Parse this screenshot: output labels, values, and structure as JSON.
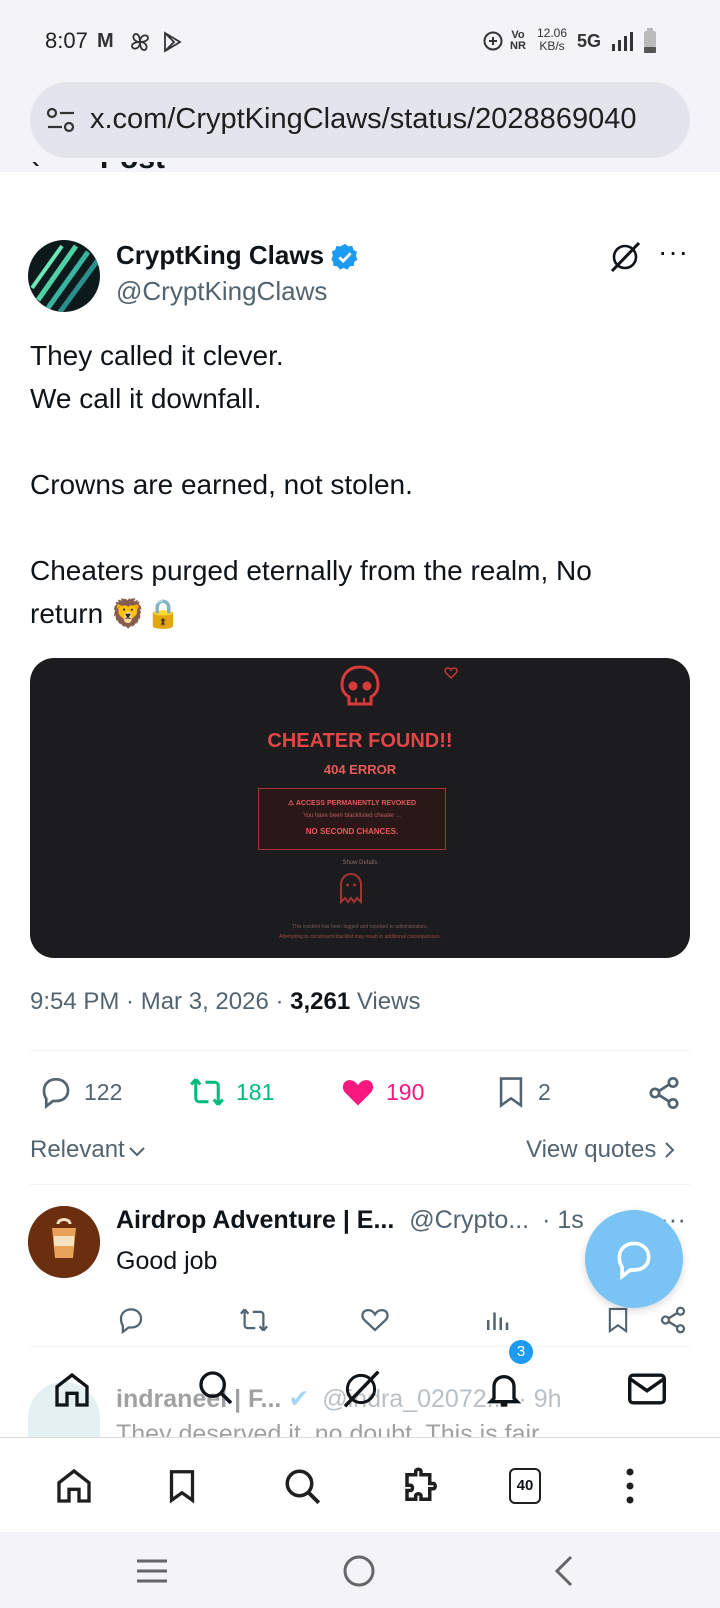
{
  "status_bar": {
    "time": "8:07",
    "app_icons": "M",
    "data_speed": "12.06",
    "data_unit": "KB/s",
    "network": "5G",
    "volte": "Vo",
    "volte2": "NR"
  },
  "browser": {
    "url": "x.com/CryptKingClaws/status/2028869040"
  },
  "page": {
    "header_title": "Post"
  },
  "post": {
    "author_name": "CryptKing Claws",
    "author_handle": "@CryptKingClaws",
    "text_lines": [
      "They called it clever.",
      "We call it downfall.",
      "",
      "Crowns are earned, not stolen.",
      "",
      "Cheaters purged eternally from the realm, No",
      "return 🦁🔒"
    ],
    "media": {
      "title": "CHEATER FOUND!!",
      "subtitle": "404 ERROR",
      "box_heading": "ACCESS PERMANENTLY REVOKED",
      "box_line": "You have been blacklisted cheater ...",
      "box_footer": "NO SECOND CHANCES.",
      "show_details": "Show Details",
      "footer_line1": "This incident has been logged and reported to administrators.",
      "footer_line2": "Attempting to circumvent blacklist may result in additional consequences."
    },
    "time": "9:54 PM",
    "date": "Mar 3, 2026",
    "views_count": "3,261",
    "views_label": "Views",
    "replies": "122",
    "reposts": "181",
    "likes": "190",
    "bookmarks": "2",
    "colors": {
      "repost": "#00ba7c",
      "like": "#f91880",
      "verified": "#1d9bf0"
    }
  },
  "replies_header": {
    "sort_label": "Relevant",
    "quotes_label": "View quotes"
  },
  "replies": [
    {
      "name": "Airdrop Adventure | E...",
      "handle": "@Crypto...",
      "age": "· 1s",
      "text": "Good job"
    },
    {
      "name": "indraneel | F...",
      "handle": "@indra_02072...",
      "age": "· 9h",
      "text": "They deserved it, no doubt. This is fair"
    }
  ],
  "x_nav": {
    "notifications_badge": "3"
  },
  "browser_bar": {
    "tabs_count": "40"
  }
}
